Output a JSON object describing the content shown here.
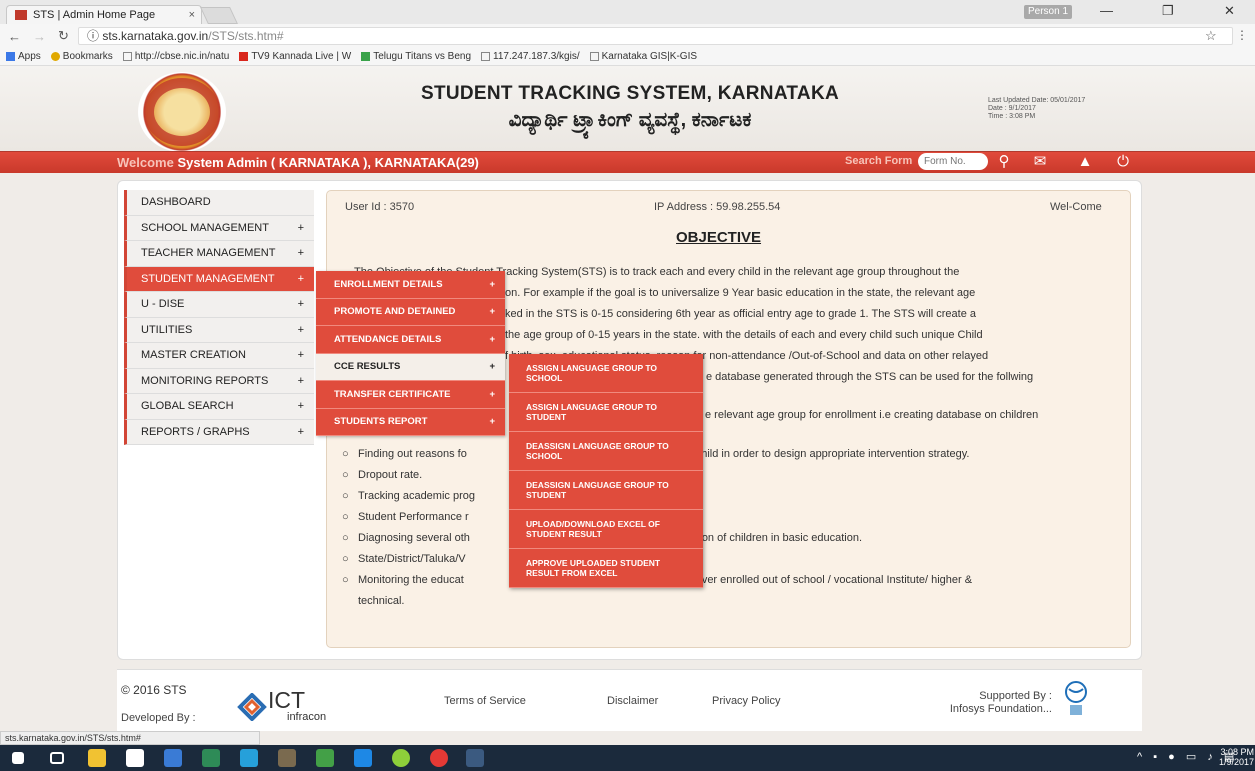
{
  "browser": {
    "tab_title": "STS | Admin Home Page",
    "tab_close": "×",
    "profile": "Person 1",
    "url_host": "sts.karnataka.gov.in",
    "url_path": "/STS/sts.htm#",
    "info_icon": "ⓘ",
    "bookmarks": [
      {
        "label": "Apps",
        "icon": "apps-grid-icon"
      },
      {
        "label": "Bookmarks",
        "icon": "star-icon"
      },
      {
        "label": "http://cbse.nic.in/natu",
        "icon": "page-icon"
      },
      {
        "label": "TV9 Kannada Live | W",
        "icon": "tv9-icon"
      },
      {
        "label": "Telugu Titans vs Beng",
        "icon": "sports-icon"
      },
      {
        "label": "117.247.187.3/kgis/",
        "icon": "page-icon"
      },
      {
        "label": "Karnataka GIS|K-GIS",
        "icon": "page-icon"
      }
    ],
    "status_url": "sts.karnataka.gov.in/STS/sts.htm#"
  },
  "header": {
    "title": "STUDENT TRACKING SYSTEM, KARNATAKA",
    "subtitle": "ವಿದ್ಯಾರ್ಥಿ ಟ್ರ್ಯಾಕಿಂಗ್ ವ್ಯವಸ್ಥೆ, ಕರ್ನಾಟಕ",
    "last_updated": "Last Updated Date: 05/01/2017",
    "date": "Date : 9/1/2017",
    "time": "Time : 3:08 PM"
  },
  "topbar": {
    "welcome_word": "Welcome",
    "user": "System Admin ( KARNATAKA ), KARNATAKA(29)",
    "search_label": "Search Form",
    "search_placeholder": "Form No."
  },
  "sidebar": [
    {
      "label": "DASHBOARD",
      "plus": ""
    },
    {
      "label": "SCHOOL MANAGEMENT",
      "plus": "+"
    },
    {
      "label": "TEACHER MANAGEMENT",
      "plus": "+"
    },
    {
      "label": "STUDENT MANAGEMENT",
      "plus": "+"
    },
    {
      "label": "U - DISE",
      "plus": "+"
    },
    {
      "label": "UTILITIES",
      "plus": "+"
    },
    {
      "label": "MASTER CREATION",
      "plus": "+"
    },
    {
      "label": "MONITORING REPORTS",
      "plus": "+"
    },
    {
      "label": "GLOBAL SEARCH",
      "plus": "+"
    },
    {
      "label": "REPORTS / GRAPHS",
      "plus": "+"
    }
  ],
  "student_menu": [
    {
      "label": "ENROLLMENT DETAILS",
      "plus": "+"
    },
    {
      "label": "PROMOTE AND DETAINED",
      "plus": "+"
    },
    {
      "label": "ATTENDANCE DETAILS",
      "plus": "+"
    },
    {
      "label": "CCE RESULTS",
      "plus": "+"
    },
    {
      "label": "TRANSFER CERTIFICATE",
      "plus": "+"
    },
    {
      "label": "STUDENTS REPORT",
      "plus": "+"
    }
  ],
  "cce_menu": [
    "ASSIGN LANGUAGE GROUP TO SCHOOL",
    "ASSIGN LANGUAGE GROUP TO STUDENT",
    "DEASSIGN LANGUAGE GROUP TO SCHOOL",
    "DEASSIGN LANGUAGE GROUP TO STUDENT",
    "UPLOAD/DOWNLOAD EXCEL OF STUDENT RESULT",
    "APPROVE UPLOADED STUDENT RESULT FROM EXCEL"
  ],
  "content": {
    "user_id": "User Id : 3570",
    "ip": "IP Address : 59.98.255.54",
    "welcome": "Wel-Come",
    "heading": "OBJECTIVE",
    "para_lines": [
      "The Objective of the Student Tracking System(STS) is to track each and every child in the relevant age group throughout the",
      "on. For example if the goal is to universalize 9 Year basic education in the state, the relevant age",
      "ked in the STS is 0-15 considering 6th year as official entry age to grade 1. The STS will create a",
      "the age group of 0-15 years in the state. with the details of each and every child such unique Child",
      "f birth, sex, educational status, reason for non-attendance /Out-of-School and data on other relayed",
      "e database generated through the STS can be used for the follwing"
    ],
    "bullets": [
      "e relevant age group for enrollment i.e creating database on children",
      "Finding out reasons fo|hool child in order to design appropriate intervention strategy.",
      "Dropout rate.",
      "Tracking academic prog|l.",
      "Student Performance r|",
      "Diagnosing several oth|etention of children in basic education.",
      "State/District/Taluka/V|",
      "Monitoring the educat|s of never enrolled out of school / vocational Institute/ higher &",
      "technical."
    ]
  },
  "footer": {
    "copyright": "© 2016 STS",
    "developed_by": "Developed By :",
    "ict": "ICT",
    "infracon": "infracon",
    "links": [
      "Terms of Service",
      "Disclaimer",
      "Privacy Policy"
    ],
    "supported_by": "Supported By :",
    "supporter": "Infosys Foundation..."
  },
  "taskbar": {
    "time": "3:08 PM",
    "date": "1/9/2017"
  },
  "colors": {
    "brand_red": "#e04c3c",
    "dark_red": "#c9392b",
    "content_bg": "#faf1e6"
  }
}
